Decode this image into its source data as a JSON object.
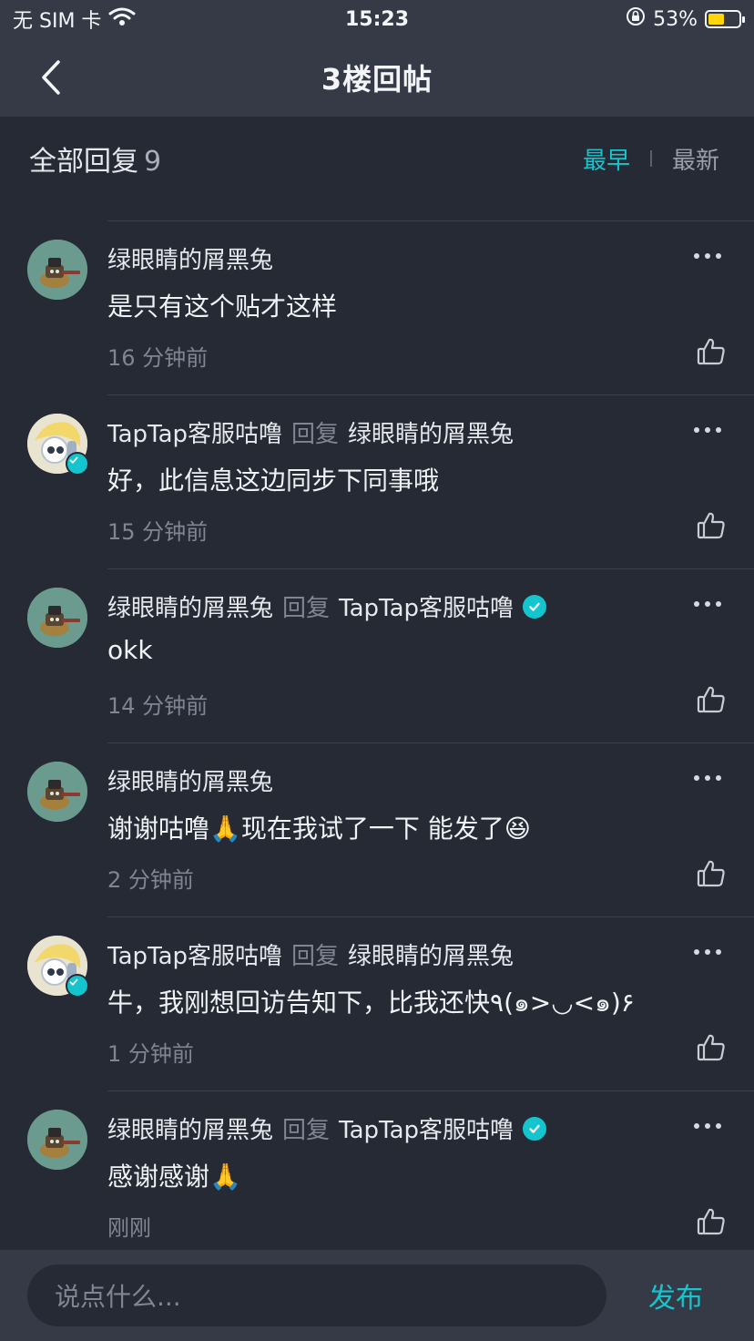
{
  "status_bar": {
    "carrier": "无 SIM 卡",
    "time": "15:23",
    "battery": "53%",
    "battery_level": 0.53
  },
  "nav": {
    "title": "3楼回帖"
  },
  "reply_header": {
    "label": "全部回复",
    "count": "9",
    "sort_earliest": "最早",
    "sort_latest": "最新"
  },
  "reply_word": "回复",
  "comments": [
    {
      "user": "绿眼睛的屑黑兔",
      "target": "",
      "body": "是只有这个贴才这样",
      "time": "16 分钟前",
      "avatar": "bunny"
    },
    {
      "user": "TapTap客服咕噜",
      "target": "绿眼睛的屑黑兔",
      "body": "好，此信息这边同步下同事哦",
      "time": "15 分钟前",
      "avatar": "service"
    },
    {
      "user": "绿眼睛的屑黑兔",
      "target": "TapTap客服咕噜",
      "body": "okk",
      "time": "14 分钟前",
      "avatar": "bunny"
    },
    {
      "user": "绿眼睛的屑黑兔",
      "target": "",
      "body": "谢谢咕噜🙏现在我试了一下 能发了😆",
      "time": "2 分钟前",
      "avatar": "bunny"
    },
    {
      "user": "TapTap客服咕噜",
      "target": "绿眼睛的屑黑兔",
      "body": "牛，我刚想回访告知下，比我还快٩(๑>◡<๑)۶",
      "time": "1 分钟前",
      "avatar": "service"
    },
    {
      "user": "绿眼睛的屑黑兔",
      "target": "TapTap客服咕噜",
      "body": "感谢感谢🙏",
      "time": "刚刚",
      "avatar": "bunny"
    }
  ],
  "input": {
    "placeholder": "说点什么...",
    "send_label": "发布"
  },
  "colors": {
    "accent": "#15c5ce",
    "background": "#262a35",
    "bar": "#353a46"
  }
}
